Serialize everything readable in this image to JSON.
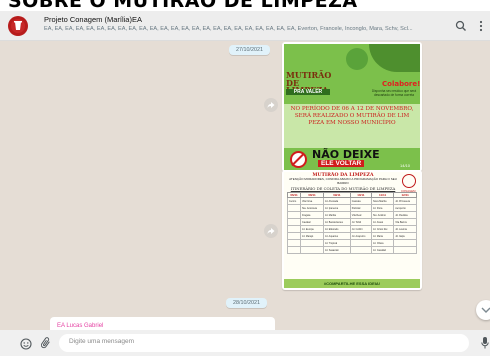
{
  "banner": {
    "text": "SOBRE O MUTIRÃO DE LIMPEZA"
  },
  "header": {
    "title": "Projeto Conagem (Marília)EA",
    "members": "EA, EA, EA, EA, EA, EA, EA, EA, EA, EA, EA, EA, EA, EA, EA, EA, EA, EA, EA, EA, EA, EA, EA, EA, Everton, Francele, Inconglo, Mara, Schv, Scl...",
    "icons": [
      "search-icon",
      "menu-icon"
    ]
  },
  "chat": {
    "date1": "27/10/2021",
    "date2": "28/10/2021",
    "sender": "EA Lucas Gabriel"
  },
  "flyer1": {
    "title": "MUTIRÃO DE LIMPEZA",
    "subtitle": "PRA VALER",
    "colab": "Colabore!",
    "colab_text": "Disponha seu resíduo que será descartado de forma correta",
    "period": "NO PERÍODO DE 06 A 12 DE NOVEMBRO, SERÁ REALIZADO O MUTIRÃO DE LIM PEZA EM NOSSO MUNICÍPIO",
    "nao": "NÃO DEIXE",
    "ele": "ELE VOLTAR",
    "number": "14/10"
  },
  "flyer2": {
    "head": "MUTIRÃO DA LIMPEZA",
    "line": "ATENÇÃO MORADORES, CONFIRA ABAIXO A PROGRAMAÇÃO PARA O SEU BAIRRO",
    "tab": "ITINERÁRIO DE COLETA DO MUTIRÃO DE LIMPEZA",
    "logo_tag": "CONAGEM",
    "columns": [
      "06/11",
      "08/11",
      "09/11",
      "10/11",
      "11/11",
      "12/11"
    ],
    "rows": [
      [
        "Centro",
        "Vila Nova",
        "Jd. Alvorada",
        "Cascata",
        "Nova Marília",
        "Jd. Primavera"
      ],
      [
        "",
        "Sta. Antonieta",
        "Jd. Ipanema",
        "Palmital",
        "Jd. Flora",
        "Aeroporto"
      ],
      [
        "",
        "Fragata",
        "Jd. Marília",
        "Vila Real",
        "Sto. Antônio",
        "Jd. Paulista"
      ],
      [
        "",
        "Cavalari",
        "Jd. Bandeirantes",
        "Jd. Tofoli",
        "Jd. Araxá",
        "Vila Barros"
      ],
      [
        "",
        "Jd. Europa",
        "Jd. Eldorado",
        "Jd. Colibri",
        "Jd. Cristo Rei",
        "Jd. Lavínia"
      ],
      [
        "",
        "Jd. Marajó",
        "Jd. Aquarius",
        "Jd. Acapulco",
        "Jd. Maria",
        "Jd. Itaipu"
      ],
      [
        "",
        "",
        "Jd. Tropical",
        "",
        "Jd. Ohara",
        ""
      ],
      [
        "",
        "",
        "Jd. Sasazaki",
        "",
        "Jd. Cavallari",
        ""
      ]
    ],
    "footer": "#COMPARTILHE ESSA IDEIA!"
  },
  "composer": {
    "placeholder": "Digite uma mensagem",
    "icons": [
      "emoji-icon",
      "attach-icon",
      "mic-icon"
    ]
  }
}
